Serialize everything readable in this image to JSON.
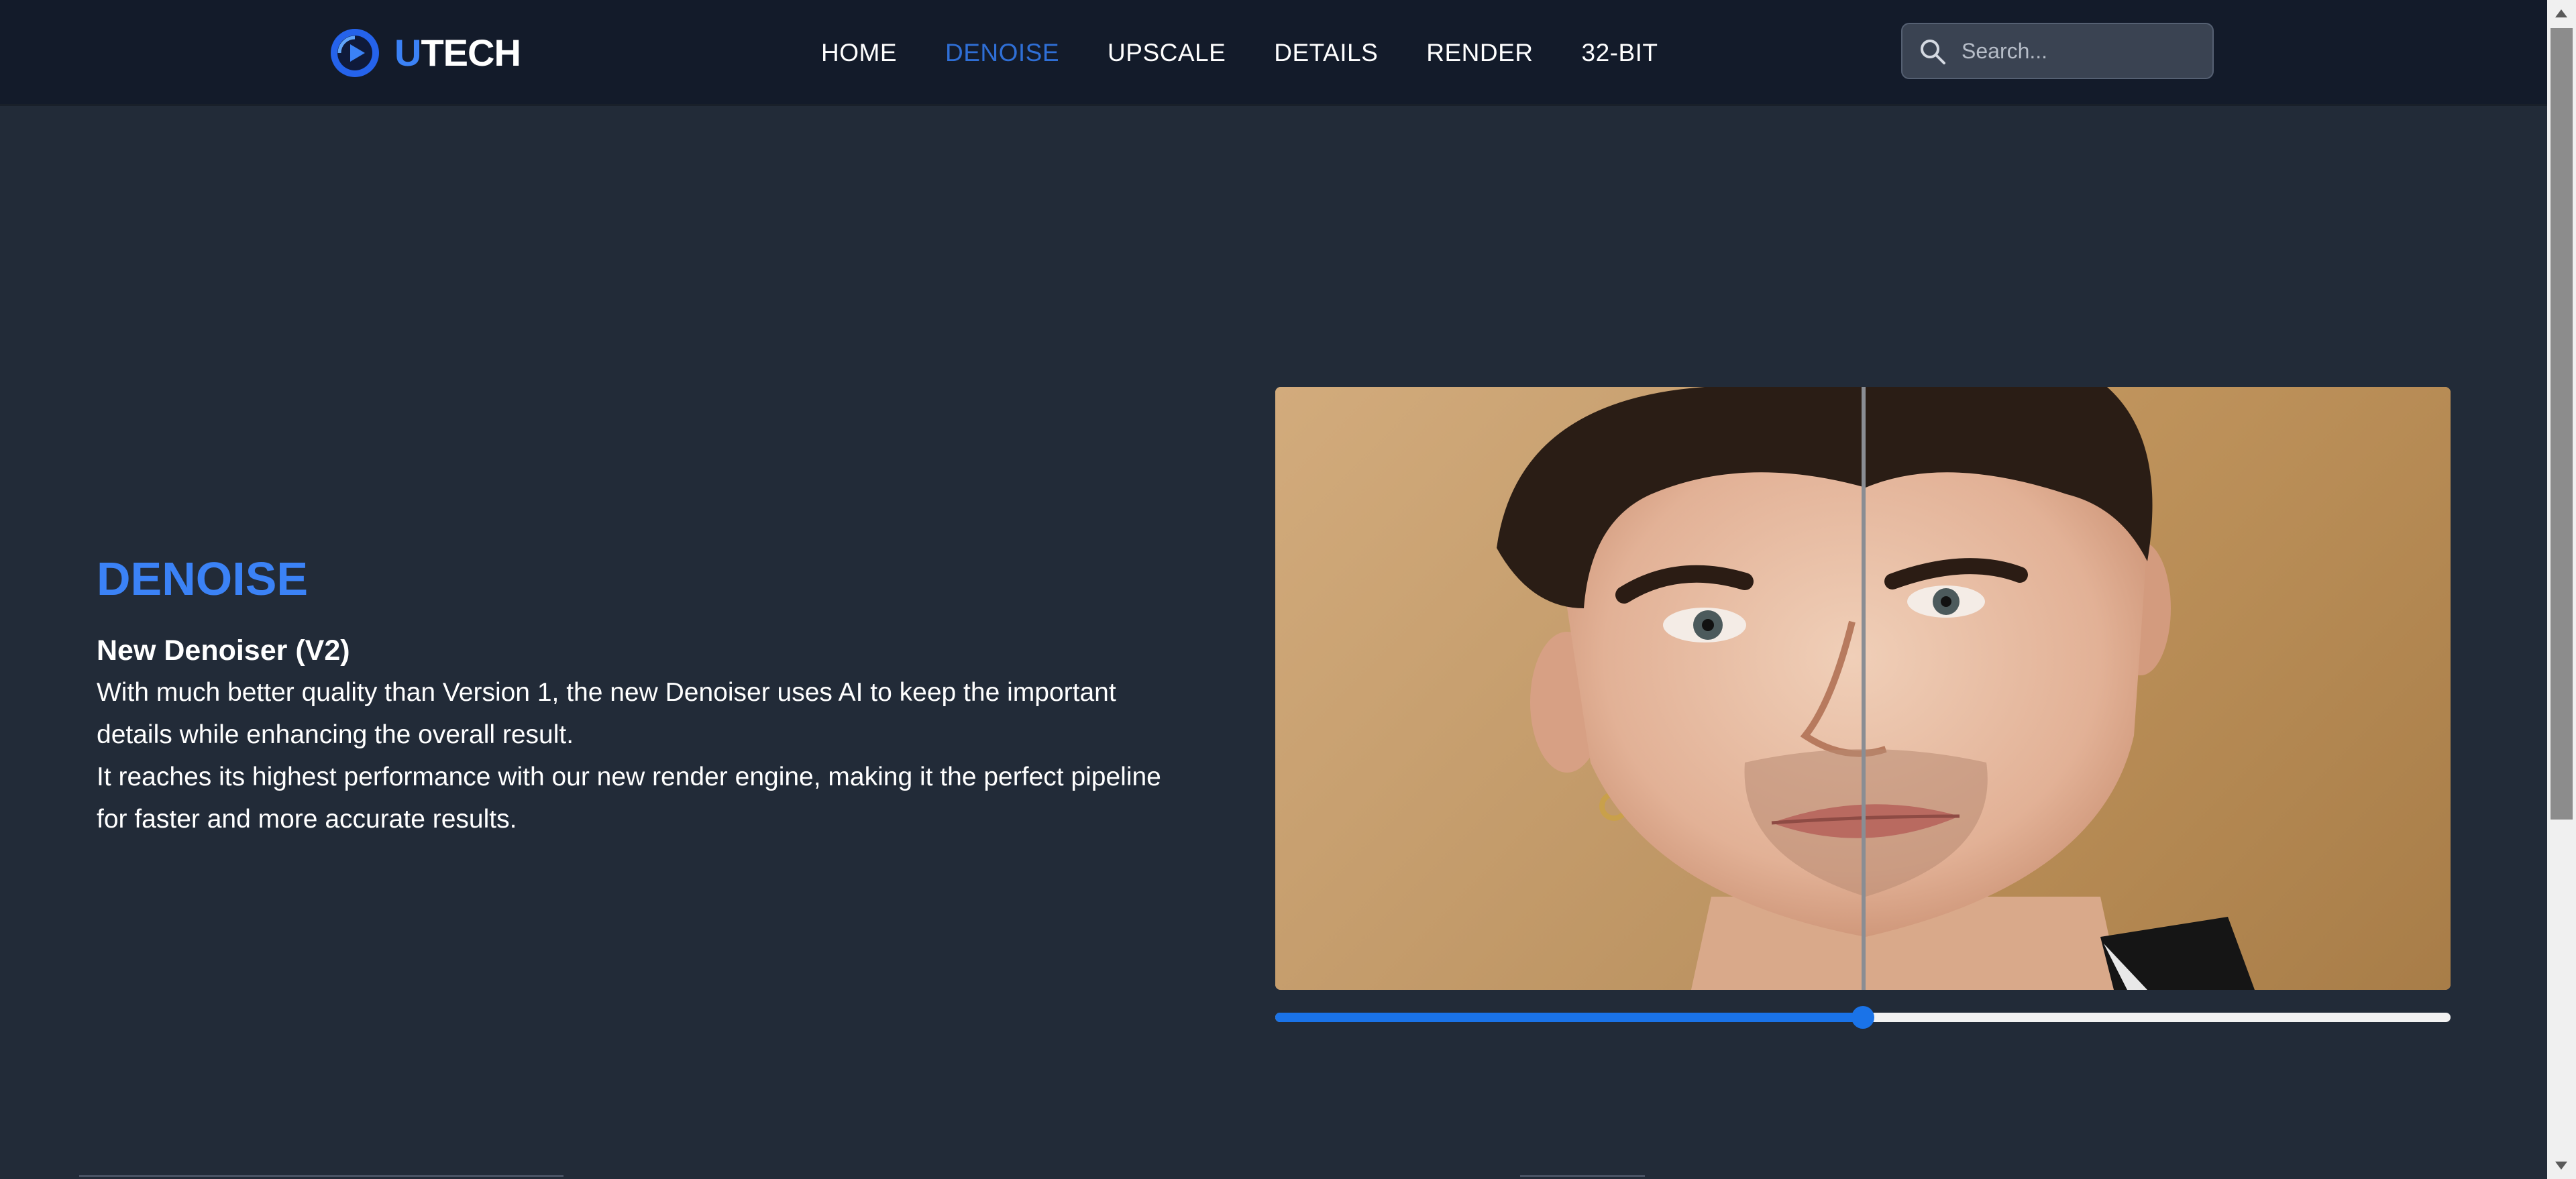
{
  "brand": {
    "logo_first": "U",
    "logo_rest": "TECH"
  },
  "nav": {
    "items": [
      {
        "label": "HOME",
        "active": false
      },
      {
        "label": "DENOISE",
        "active": true
      },
      {
        "label": "UPSCALE",
        "active": false
      },
      {
        "label": "DETAILS",
        "active": false
      },
      {
        "label": "RENDER",
        "active": false
      },
      {
        "label": "32-BIT",
        "active": false
      }
    ]
  },
  "search": {
    "placeholder": "Search...",
    "value": ""
  },
  "section": {
    "title": "DENOISE",
    "subtitle": "New Denoiser (V2)",
    "paragraphs": [
      "With much better quality than Version 1, the new Denoiser uses AI to keep the important details while enhancing the overall result.",
      "It reaches its highest performance with our new render engine, making it the perfect pipeline for faster and more accurate results."
    ]
  },
  "comparison": {
    "slider_percent": 50
  },
  "colors": {
    "accent": "#3b82f6",
    "nav_active": "#2f6fd6",
    "header_bg": "#131b2a",
    "page_bg": "#222b38",
    "slider_fill": "#1a73e8"
  },
  "icons": [
    "logo-play-icon",
    "search-icon"
  ]
}
